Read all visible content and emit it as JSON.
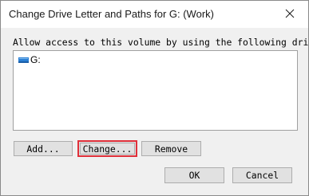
{
  "window": {
    "title": "Change Drive Letter and Paths for G: (Work)",
    "close_icon": "close-icon"
  },
  "dialog": {
    "description": "Allow access to this volume by using the following drive",
    "list_items": [
      {
        "label": "G:",
        "icon": "drive-icon"
      }
    ]
  },
  "buttons": {
    "add_label": "Add...",
    "change_label": "Change...",
    "remove_label": "Remove",
    "ok_label": "OK",
    "cancel_label": "Cancel"
  },
  "colors": {
    "highlight": "#e0303a",
    "drive_icon": "#2a7fd4"
  }
}
